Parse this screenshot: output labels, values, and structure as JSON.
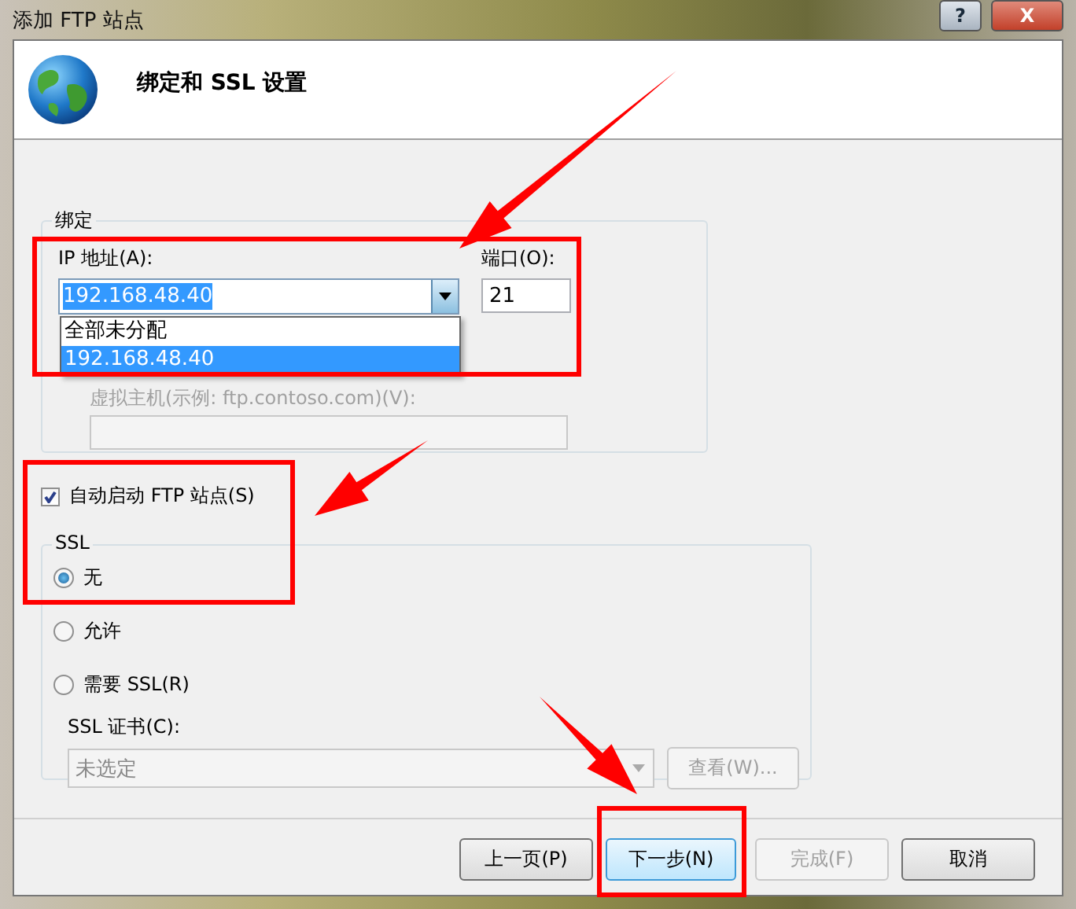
{
  "window": {
    "title": "添加 FTP 站点",
    "buttons": [
      "?",
      "X"
    ]
  },
  "header": {
    "title": "绑定和 SSL 设置"
  },
  "binding": {
    "legend": "绑定",
    "ip_label": "IP 地址(A):",
    "ip_value": "192.168.48.40",
    "port_label": "端口(O):",
    "port_value": "21",
    "ip_options": [
      {
        "label": "全部未分配",
        "selected": false
      },
      {
        "label": "192.168.48.40",
        "selected": true
      }
    ],
    "host_label": "虚拟主机(示例: ftp.contoso.com)(V):"
  },
  "auto_start": {
    "label": "自动启动 FTP 站点(S)",
    "checked": true
  },
  "ssl": {
    "legend": "SSL",
    "options": [
      {
        "label": "无",
        "selected": true
      },
      {
        "label": "允许",
        "selected": false
      },
      {
        "label": "需要 SSL(R)",
        "selected": false
      }
    ],
    "cert_label": "SSL 证书(C):",
    "cert_value": "未选定",
    "view_button": {
      "label": "查看(W)...",
      "disabled": true
    }
  },
  "buttons": [
    {
      "label": "上一页(P)",
      "disabled": false,
      "focused": false
    },
    {
      "label": "下一步(N)",
      "disabled": false,
      "focused": true
    },
    {
      "label": "完成(F)",
      "disabled": true,
      "focused": false
    },
    {
      "label": "取消",
      "disabled": false,
      "focused": false
    }
  ]
}
